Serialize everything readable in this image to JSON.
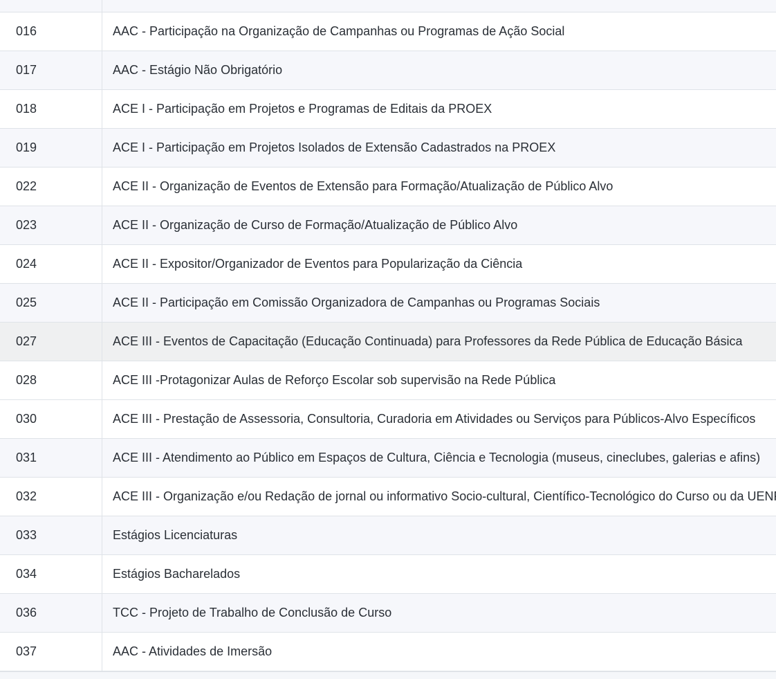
{
  "table": {
    "rows": [
      {
        "code": "016",
        "description": "AAC - Participação na Organização de Campanhas ou Programas de Ação Social"
      },
      {
        "code": "017",
        "description": "AAC - Estágio Não Obrigatório"
      },
      {
        "code": "018",
        "description": "ACE I - Participação em Projetos e Programas de Editais da PROEX"
      },
      {
        "code": "019",
        "description": "ACE I - Participação em Projetos Isolados de Extensão Cadastrados na PROEX"
      },
      {
        "code": "022",
        "description": "ACE II - Organização de Eventos de Extensão para Formação/Atualização de Público Alvo"
      },
      {
        "code": "023",
        "description": "ACE II - Organização de Curso de Formação/Atualização de Público Alvo"
      },
      {
        "code": "024",
        "description": "ACE II - Expositor/Organizador de Eventos para Popularização da Ciência"
      },
      {
        "code": "025",
        "description": "ACE II - Participação em Comissão Organizadora de Campanhas ou Programas Sociais"
      },
      {
        "code": "027",
        "description": "ACE III - Eventos de Capacitação (Educação Continuada) para Professores da Rede Pública de Educação Básica"
      },
      {
        "code": "028",
        "description": "ACE III -Protagonizar Aulas de Reforço Escolar sob supervisão na Rede Pública"
      },
      {
        "code": "030",
        "description": "ACE III - Prestação de Assessoria, Consultoria, Curadoria em Atividades ou Serviços para Públicos-Alvo Específicos"
      },
      {
        "code": "031",
        "description": "ACE III - Atendimento ao Público em Espaços de Cultura, Ciência e Tecnologia (museus, cineclubes, galerias e afins)"
      },
      {
        "code": "032",
        "description": "ACE III - Organização e/ou Redação de jornal ou informativo Socio-cultural, Científico-Tecnológico do Curso ou da UENF"
      },
      {
        "code": "033",
        "description": "Estágios Licenciaturas"
      },
      {
        "code": "034",
        "description": "Estágios Bacharelados"
      },
      {
        "code": "036",
        "description": "TCC - Projeto de Trabalho de Conclusão de Curso"
      },
      {
        "code": "037",
        "description": "AAC - Atividades de Imersão"
      }
    ]
  }
}
